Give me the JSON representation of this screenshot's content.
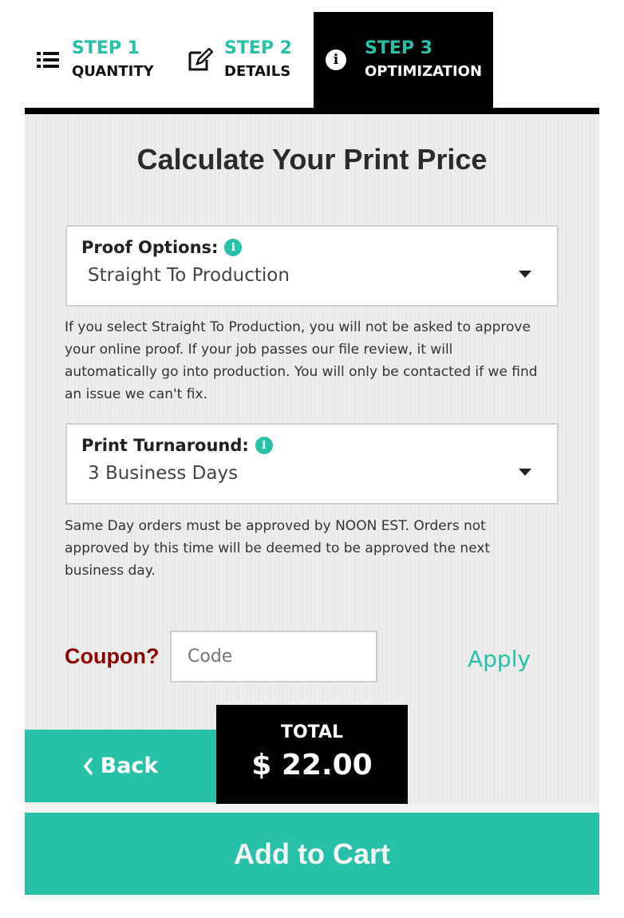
{
  "steps": [
    {
      "step": "STEP 1",
      "label": "QUANTITY",
      "icon": "list-icon"
    },
    {
      "step": "STEP 2",
      "label": "DETAILS",
      "icon": "edit-icon"
    },
    {
      "step": "STEP 3",
      "label": "OPTIMIZATION",
      "icon": "info-icon",
      "active": true
    }
  ],
  "title": "Calculate Your Print Price",
  "proof": {
    "label": "Proof Options:",
    "value": "Straight To Production",
    "note": "If you select Straight To Production, you will not be asked to approve your online proof. If your job passes our file review, it will automatically go into production. You will only be contacted if we find an issue we can't fix."
  },
  "turnaround": {
    "label": "Print Turnaround:",
    "value": "3 Business Days",
    "note": "Same Day orders must be approved by NOON EST. Orders not approved by this time will be deemed to be approved the next business day."
  },
  "coupon": {
    "label": "Coupon?",
    "placeholder": "Code",
    "apply": "Apply"
  },
  "back": "Back",
  "total": {
    "label": "TOTAL",
    "price": "$ 22.00"
  },
  "add_to_cart": "Add to Cart",
  "colors": {
    "accent": "#26c1a8",
    "coupon": "#8b0000",
    "dark": "#000000"
  }
}
